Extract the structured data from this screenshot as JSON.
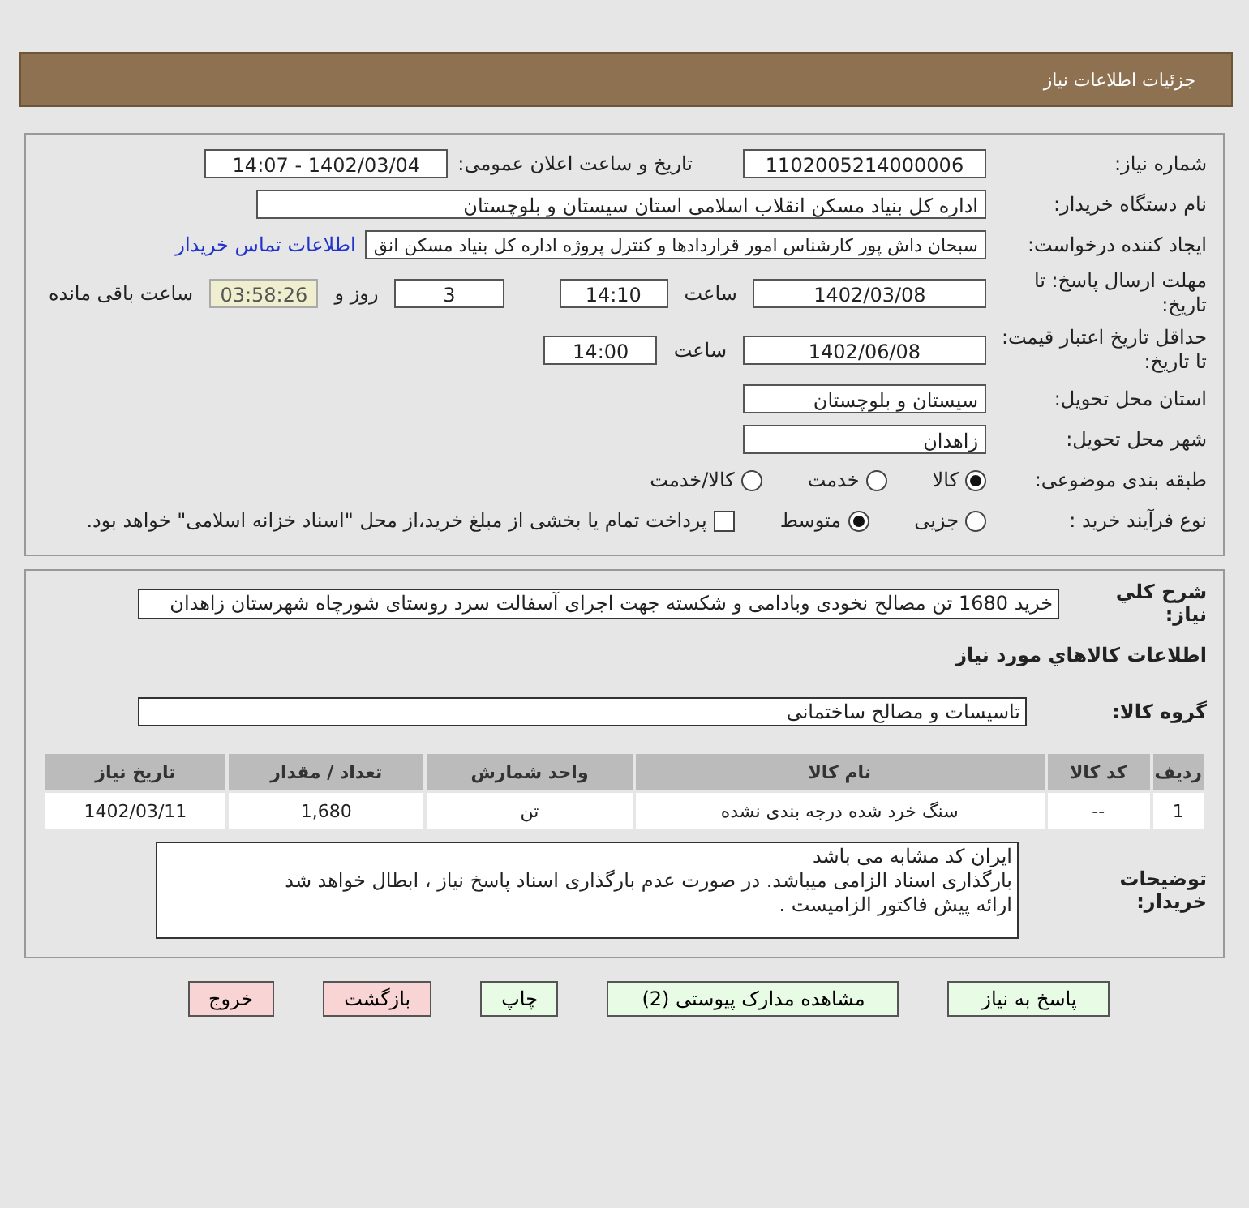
{
  "header": {
    "title": "جزئیات اطلاعات نیاز"
  },
  "need_number": {
    "label": "شماره نیاز:",
    "value": "1102005214000006"
  },
  "announce": {
    "label": "تاریخ و ساعت اعلان عمومی:",
    "value": "1402/03/04 - 14:07"
  },
  "buyer_org": {
    "label": "نام دستگاه خریدار:",
    "value": "اداره کل بنیاد مسکن انقلاب اسلامی استان سیستان و بلوچستان"
  },
  "requester": {
    "label": "ایجاد کننده درخواست:",
    "value": "سبحان داش پور کارشناس امور قراردادها و کنترل پروژه اداره کل بنیاد مسکن انق",
    "link": "اطلاعات تماس خریدار"
  },
  "deadline": {
    "label": "مهلت ارسال پاسخ: تا تاریخ:",
    "date": "1402/03/08",
    "time_label": "ساعت",
    "time": "14:10",
    "days": "3",
    "days_label": "روز و",
    "remaining": "03:58:26",
    "remaining_label": "ساعت باقی مانده"
  },
  "validity": {
    "label": "حداقل تاریخ اعتبار قیمت: تا تاریخ:",
    "date": "1402/06/08",
    "time_label": "ساعت",
    "time": "14:00"
  },
  "province": {
    "label": "استان محل تحویل:",
    "value": "سیستان و بلوچستان"
  },
  "city": {
    "label": "شهر محل تحویل:",
    "value": "زاهدان"
  },
  "category": {
    "label": "طبقه بندی موضوعی:",
    "options": [
      {
        "label": "کالا",
        "selected": true
      },
      {
        "label": "خدمت",
        "selected": false
      },
      {
        "label": "کالا/خدمت",
        "selected": false
      }
    ]
  },
  "process": {
    "label": "نوع فرآیند خرید :",
    "options": [
      {
        "label": "جزیی",
        "selected": false
      },
      {
        "label": "متوسط",
        "selected": true
      }
    ],
    "checkbox": {
      "label": "پرداخت تمام یا بخشی از مبلغ خرید،از محل \"اسناد خزانه اسلامی\" خواهد بود.",
      "checked": false
    }
  },
  "description": {
    "label": "شرح کلي نياز:",
    "value": "خرید 1680 تن مصالح نخودی وبادامی و شکسته جهت اجرای آسفالت سرد روستای شورچاه شهرستان زاهدان"
  },
  "goods_title": "اطلاعات کالاهاي مورد نياز",
  "goods_group": {
    "label": "گروه کالا:",
    "value": "تاسیسات و مصالح ساختمانی"
  },
  "table": {
    "columns": [
      "ردیف",
      "کد کالا",
      "نام کالا",
      "واحد شمارش",
      "تعداد / مقدار",
      "تاریخ نیاز"
    ],
    "rows": [
      [
        "1",
        "--",
        "سنگ خرد شده درجه بندی نشده",
        "تن",
        "1,680",
        "1402/03/11"
      ]
    ]
  },
  "buyer_notes": {
    "label": "توضیحات خریدار:",
    "lines": [
      "ایران کد مشابه می باشد",
      "بارگذاری اسناد الزامی میباشد. در صورت عدم بارگذاری اسناد پاسخ نیاز ، ابطال خواهد شد",
      "ارائه پیش فاکتور الزامیست ."
    ]
  },
  "buttons": [
    {
      "label": "پاسخ به نیاز",
      "kind": "primary"
    },
    {
      "label": "مشاهده مدارک پیوستی (2)",
      "kind": "primary"
    },
    {
      "label": "چاپ",
      "kind": "primary"
    },
    {
      "label": "بازگشت",
      "kind": "danger"
    },
    {
      "label": "خروج",
      "kind": "danger"
    }
  ]
}
